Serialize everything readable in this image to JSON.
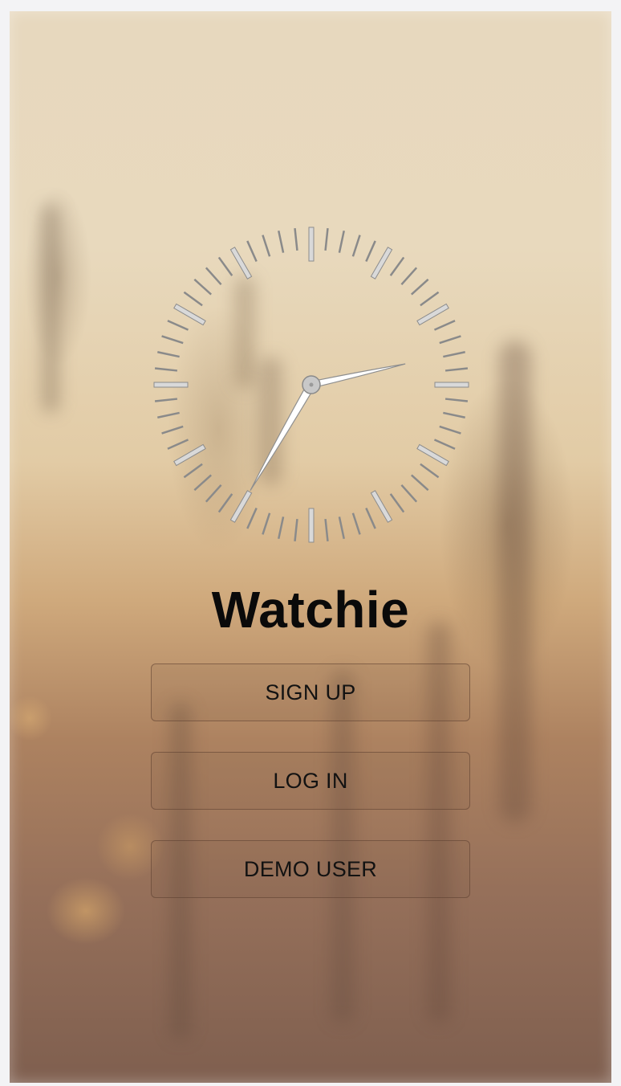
{
  "app": {
    "title": "Watchie"
  },
  "clock": {
    "hour": 2,
    "minute": 35,
    "color_hands": "#ffffff",
    "color_ticks": "#8a8a8a"
  },
  "buttons": {
    "sign_up": "SIGN UP",
    "log_in": "LOG IN",
    "demo_user": "DEMO USER"
  }
}
